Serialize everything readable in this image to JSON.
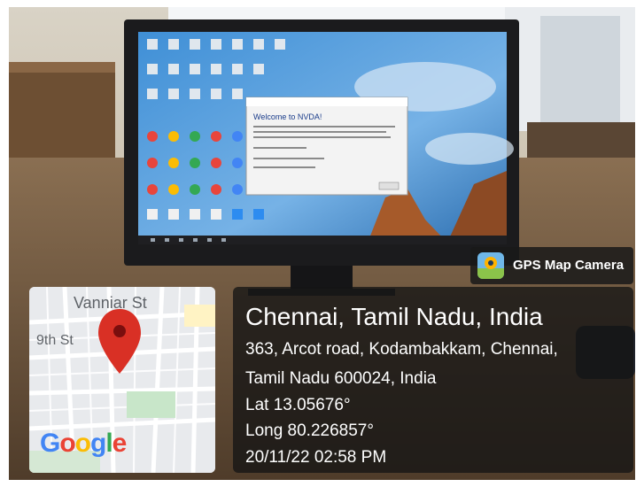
{
  "badge": {
    "label": "GPS Map Camera",
    "icon": "gps-map-camera-icon"
  },
  "map": {
    "street_top": "Vanniar St",
    "street_left": "9th St",
    "logo": [
      "G",
      "o",
      "o",
      "g",
      "l",
      "e"
    ],
    "logo_colors": [
      "#4285F4",
      "#EA4335",
      "#FBBC05",
      "#4285F4",
      "#34A853",
      "#EA4335"
    ],
    "pin_color": "#d93025"
  },
  "location": {
    "title": "Chennai, Tamil Nadu, India",
    "address_line1": "363, Arcot road, Kodambakkam, Chennai,",
    "address_line2": "Tamil Nadu 600024, India",
    "latitude": "Lat 13.05676°",
    "longitude": "Long 80.226857°",
    "datetime": "20/11/22 02:58 PM"
  },
  "screen": {
    "dialog_title": "Welcome to NVDA!"
  }
}
